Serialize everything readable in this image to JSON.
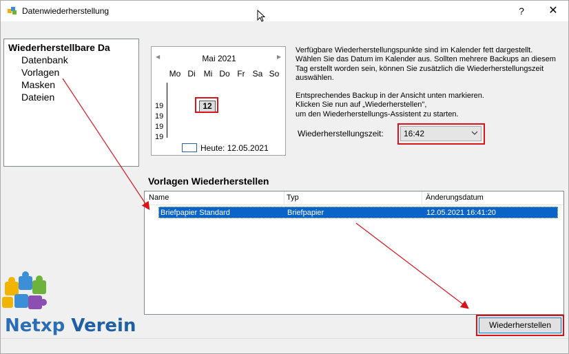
{
  "window": {
    "title": "Datenwiederherstellung",
    "help_label": "?",
    "close_label": "✕"
  },
  "tree": {
    "root": "Wiederherstellbare Da",
    "items": [
      {
        "label": "Datenbank"
      },
      {
        "label": "Vorlagen"
      },
      {
        "label": "Masken"
      },
      {
        "label": "Dateien"
      }
    ]
  },
  "calendar": {
    "month": "Mai 2021",
    "prev": "◀",
    "next": "▶",
    "weekdays": [
      "Mo",
      "Di",
      "Mi",
      "Do",
      "Fr",
      "Sa",
      "So"
    ],
    "weeks": [
      "19",
      "19",
      "19",
      "19"
    ],
    "selected_day": "12",
    "today_label": "Heute: 12.05.2021"
  },
  "info": {
    "p1": "Verfügbare Wiederherstellungspunkte sind im Kalender fett dargestellt. Wählen Sie das Datum im Kalender aus. Sollten mehrere Backups an diesem Tag erstellt worden sein, können Sie zusätzlich die Wiederherstellungszeit auswählen.",
    "p2_1": "Entsprechendes Backup in der Ansicht unten markieren.",
    "p2_2": "Klicken Sie nun auf „Wiederherstellen\",",
    "p2_3": "um den Wiederherstellungs-Assistent zu starten."
  },
  "time": {
    "label": "Wiederherstellungszeit:",
    "value": "16:42"
  },
  "section": {
    "title": "Vorlagen Wiederherstellen"
  },
  "grid": {
    "columns": [
      "Name",
      "Typ",
      "Änderungsdatum"
    ],
    "rows": [
      {
        "name": "Briefpapier Standard",
        "type": "Briefpapier",
        "date": "12.05.2021 16:41:20"
      }
    ]
  },
  "buttons": {
    "restore": "Wiederherstellen"
  },
  "brand": {
    "part1": "Netxp ",
    "part2": "Verein"
  },
  "colors": {
    "highlight": "#d8141b",
    "selection": "#0a64c8",
    "brand": "#2a6fb6"
  }
}
